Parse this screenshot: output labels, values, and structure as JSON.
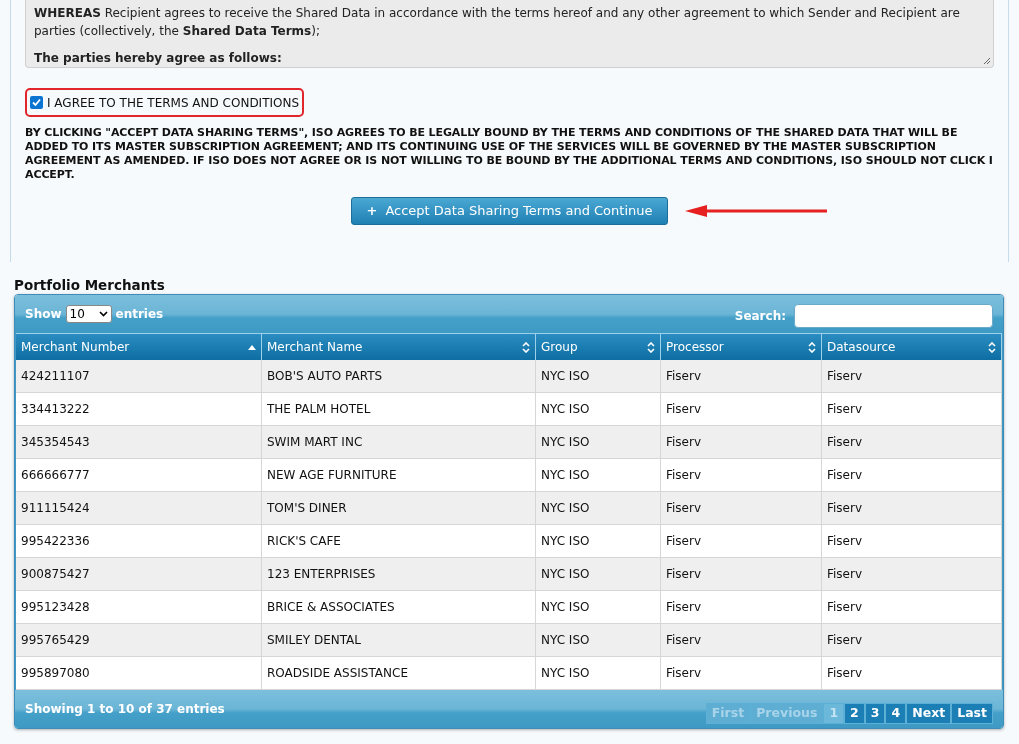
{
  "terms_box": {
    "whereas": "**WHEREAS** Recipient agrees to receive the Shared Data in accordance with the terms hereof and any other agreement to which Sender and Recipient are parties (collectively, the **Shared Data Terms**);",
    "agree_heading": "The parties hereby agree as follows:"
  },
  "agree_checkbox": {
    "label": "I AGREE TO THE TERMS AND CONDITIONS",
    "checked": true
  },
  "disclaimer": "BY CLICKING \"ACCEPT DATA SHARING TERMS\", ISO AGREES TO BE LEGALLY BOUND BY THE TERMS AND CONDITIONS OF THE SHARED DATA THAT WILL BE ADDED TO ITS MASTER SUBSCRIPTION AGREEMENT; AND ITS CONTINUING USE OF THE SERVICES WILL BE GOVERNED BY THE MASTER SUBSCRIPTION AGREEMENT AS AMENDED. IF ISO DOES NOT AGREE OR IS NOT WILLING TO BE BOUND BY THE ADDITIONAL TERMS AND CONDITIONS, ISO SHOULD NOT CLICK I ACCEPT.",
  "accept_button": {
    "icon": "+",
    "label": "Accept Data Sharing Terms and Continue"
  },
  "section_title": "Portfolio Merchants",
  "table": {
    "show_label": "Show",
    "page_size": "10",
    "entries_label": "entries",
    "search_label": "Search:",
    "columns": [
      {
        "label": "Merchant Number",
        "sorted_ascending": true
      },
      {
        "label": "Merchant Name",
        "sorted_ascending": false
      },
      {
        "label": "Group",
        "sorted_ascending": false
      },
      {
        "label": "Processor",
        "sorted_ascending": false
      },
      {
        "label": "Datasource",
        "sorted_ascending": false
      }
    ],
    "rows": [
      [
        "424211107",
        "BOB'S AUTO PARTS",
        "NYC ISO",
        "Fiserv",
        "Fiserv"
      ],
      [
        "334413222",
        "THE PALM HOTEL",
        "NYC ISO",
        "Fiserv",
        "Fiserv"
      ],
      [
        "345354543",
        "SWIM MART INC",
        "NYC ISO",
        "Fiserv",
        "Fiserv"
      ],
      [
        "666666777",
        "NEW AGE FURNITURE",
        "NYC ISO",
        "Fiserv",
        "Fiserv"
      ],
      [
        "911115424",
        "TOM'S DINER",
        "NYC ISO",
        "Fiserv",
        "Fiserv"
      ],
      [
        "995422336",
        "RICK'S CAFE",
        "NYC ISO",
        "Fiserv",
        "Fiserv"
      ],
      [
        "900875427",
        "123 ENTERPRISES",
        "NYC ISO",
        "Fiserv",
        "Fiserv"
      ],
      [
        "995123428",
        "BRICE & ASSOCIATES",
        "NYC ISO",
        "Fiserv",
        "Fiserv"
      ],
      [
        "995765429",
        "SMILEY DENTAL",
        "NYC ISO",
        "Fiserv",
        "Fiserv"
      ],
      [
        "995897080",
        "ROADSIDE ASSISTANCE",
        "NYC ISO",
        "Fiserv",
        "Fiserv"
      ]
    ],
    "info": "Showing 1 to 10 of 37 entries",
    "pagination": [
      {
        "label": "First",
        "disabled": true,
        "selected": false
      },
      {
        "label": "Previous",
        "disabled": true,
        "selected": false
      },
      {
        "label": "1",
        "disabled": false,
        "selected": true
      },
      {
        "label": "2",
        "disabled": false,
        "selected": false
      },
      {
        "label": "3",
        "disabled": false,
        "selected": false
      },
      {
        "label": "4",
        "disabled": false,
        "selected": false
      },
      {
        "label": "Next",
        "disabled": false,
        "selected": false
      },
      {
        "label": "Last",
        "disabled": false,
        "selected": false
      }
    ]
  }
}
